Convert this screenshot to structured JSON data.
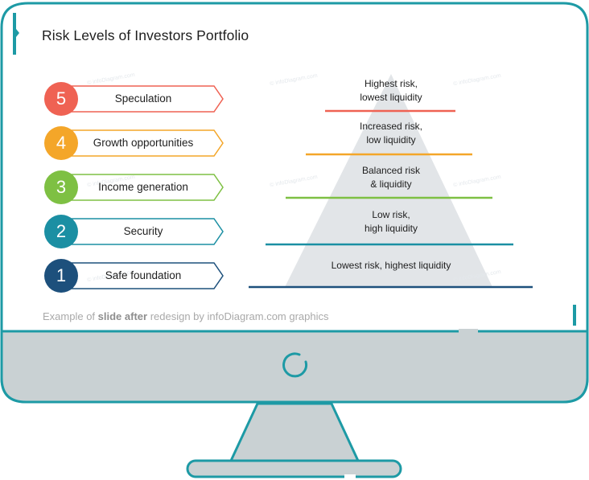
{
  "slide": {
    "title": "Risk Levels of Investors Portfolio",
    "watermark": "© infoDiagram.com"
  },
  "levels": [
    {
      "number": "5",
      "label": "Speculation",
      "color": "#ef6253"
    },
    {
      "number": "4",
      "label": "Growth opportunities",
      "color": "#f4a629"
    },
    {
      "number": "3",
      "label": "Income generation",
      "color": "#7ec043"
    },
    {
      "number": "2",
      "label": "Security",
      "color": "#1b8fa3"
    },
    {
      "number": "1",
      "label": "Safe foundation",
      "color": "#1d507c"
    }
  ],
  "pyramid": {
    "fill": "#e2e5e8",
    "tiers": [
      {
        "line1": "Highest risk,",
        "line2": "lowest liquidity",
        "color": "#ef6253"
      },
      {
        "line1": "Increased risk,",
        "line2": "low liquidity",
        "color": "#f4a629"
      },
      {
        "line1": "Balanced risk",
        "line2": "& liquidity",
        "color": "#7ec043"
      },
      {
        "line1": "Low risk,",
        "line2": "high liquidity",
        "color": "#1b8fa3"
      },
      {
        "line1": "Lowest risk, highest liquidity",
        "line2": "",
        "color": "#1d507c"
      }
    ]
  },
  "footer": {
    "prefix": "Example of ",
    "bold": "slide after",
    "suffix": " redesign by infoDiagram.com graphics"
  },
  "monitor": {
    "frame_color": "#1d9aa5",
    "bezel_color": "#c9d1d3"
  }
}
